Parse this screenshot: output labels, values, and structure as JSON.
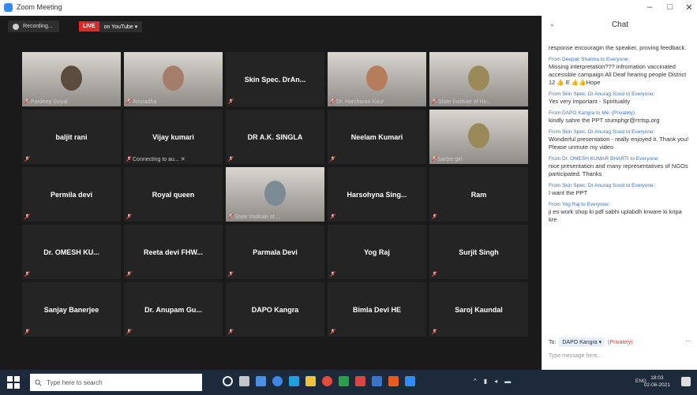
{
  "window": {
    "title": "Zoom Meeting",
    "min": "–",
    "max": "□",
    "close": "✕"
  },
  "toolbar": {
    "recording": "Recording...",
    "live": "LIVE",
    "stream": "on YouTube ▾"
  },
  "tiles": [
    {
      "name": "",
      "sub": "Pardeep Goyal",
      "video": true,
      "active": false
    },
    {
      "name": "",
      "sub": "Anuradha",
      "video": true,
      "active": false
    },
    {
      "name": "Skin Spec. DrAn...",
      "sub": "",
      "video": false,
      "active": false
    },
    {
      "name": "",
      "sub": "Dr. Harcharan Kaur",
      "video": true,
      "active": false
    },
    {
      "name": "",
      "sub": "State Institute of He...",
      "video": true,
      "active": true
    },
    {
      "name": "baljit rani",
      "sub": "",
      "video": false,
      "active": false
    },
    {
      "name": "Vijay kumari",
      "sub": "Connecting to au... ✕",
      "video": false,
      "active": false
    },
    {
      "name": "DR A.K. SINGLA",
      "sub": "",
      "video": false,
      "active": false
    },
    {
      "name": "Neelam Kumari",
      "sub": "",
      "video": false,
      "active": false
    },
    {
      "name": "",
      "sub": "barbie girl",
      "video": true,
      "active": false
    },
    {
      "name": "Permila devi",
      "sub": "",
      "video": false,
      "active": false
    },
    {
      "name": "Royal queen",
      "sub": "",
      "video": false,
      "active": false
    },
    {
      "name": "",
      "sub": "State Institute of ...",
      "video": true,
      "active": false
    },
    {
      "name": "Harsohyna Sing...",
      "sub": "",
      "video": false,
      "active": false
    },
    {
      "name": "Ram",
      "sub": "",
      "video": false,
      "active": false
    },
    {
      "name": "Dr. OMESH KU...",
      "sub": "",
      "video": false,
      "active": false
    },
    {
      "name": "Reeta devi FHW...",
      "sub": "",
      "video": false,
      "active": false
    },
    {
      "name": "Parmala Devi",
      "sub": "",
      "video": false,
      "active": false
    },
    {
      "name": "Yog Raj",
      "sub": "",
      "video": false,
      "active": false
    },
    {
      "name": "Surjit Singh",
      "sub": "",
      "video": false,
      "active": false
    },
    {
      "name": "Sanjay Banerjee",
      "sub": "",
      "video": false,
      "active": false
    },
    {
      "name": "Dr. Anupam Gu...",
      "sub": "",
      "video": false,
      "active": false
    },
    {
      "name": "DAPO Kangra",
      "sub": "",
      "video": false,
      "active": false
    },
    {
      "name": "Bimla Devi HE",
      "sub": "",
      "video": false,
      "active": false
    },
    {
      "name": "Saroj Kaundal",
      "sub": "",
      "video": false,
      "active": false
    }
  ],
  "chat": {
    "title": "Chat",
    "chevron": "⌄",
    "messages": [
      {
        "from": "",
        "text": "response encouragin the speaker, proving feedback."
      },
      {
        "from": "From Deepak Sharma to Everyone:",
        "text": "Missing interpretation??? infromation vaccinated accessible campaign All Deaf hearing people District 12 👍 E 👍👍Hope"
      },
      {
        "from": "From Skin Spec. Dr Anurag Sood to Everyone:",
        "text": "Yes very important - Spirituality"
      },
      {
        "from": "From DAPO Kangra to Me: (Privately)",
        "text": "kindly sahre the PPT stumphgr@rrrtsp.org"
      },
      {
        "from": "From Skin Spec. Dr Anurag Sood to Everyone:",
        "text": "Wonderful presentation - really enjoyed it. Thank you! Please unmute my video"
      },
      {
        "from": "From Dr. OMESH KUMAR BHARTI to Everyone:",
        "text": "nice presentation and many representatives of NGOs participated. Thanks"
      },
      {
        "from": "From Skin Spec. Dr Anurag Sood to Everyone:",
        "text": "I want the PPT"
      },
      {
        "from": "From Yog Raj to Everyone:",
        "text": "ji es work shop ki pdf sabhi uplabdh krware ki kripa kre"
      }
    ],
    "to_label": "To:",
    "to_value": "DAPO Kangra ▾",
    "privately": "(Privately)",
    "placeholder": "Type message here...",
    "more": "···"
  },
  "taskbar": {
    "search_placeholder": "Type here to search",
    "lang": "ENG",
    "time": "18:03",
    "date": "02-06-2021"
  }
}
